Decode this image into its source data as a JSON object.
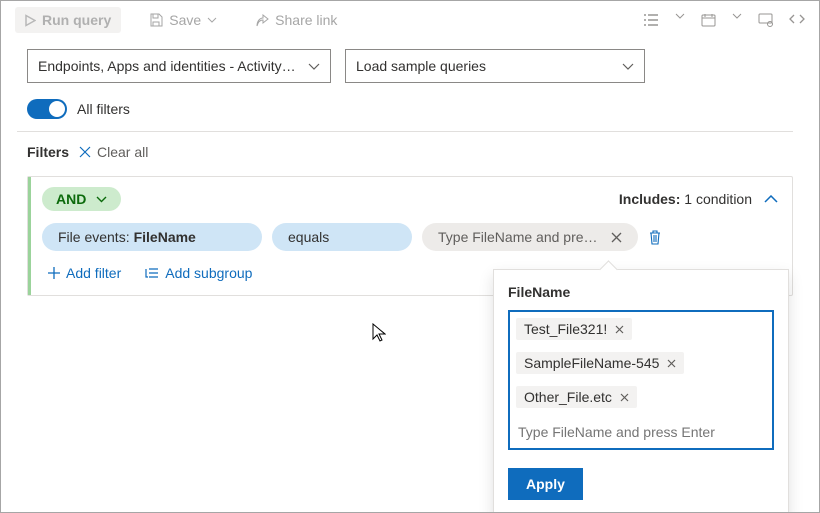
{
  "toolbar": {
    "run_label": "Run query",
    "save_label": "Save",
    "share_label": "Share link"
  },
  "dropdowns": {
    "scope": "Endpoints, Apps and identities - Activity…",
    "samples": "Load sample queries"
  },
  "toggle": {
    "all_filters_label": "All filters"
  },
  "filters_bar": {
    "label": "Filters",
    "clear_label": "Clear all"
  },
  "group": {
    "operator": "AND",
    "includes_prefix": "Includes:",
    "includes_value": "1 condition",
    "field_chip_prefix": "File events: ",
    "field_chip_value": "FileName",
    "op_chip": "equals",
    "value_chip_placeholder": "Type FileName and press …",
    "add_filter_label": "Add filter",
    "add_subgroup_label": "Add subgroup"
  },
  "popover": {
    "title": "FileName",
    "tags": [
      "Test_File321!",
      "SampleFileName-545",
      "Other_File.etc"
    ],
    "input_placeholder": "Type FileName and press Enter",
    "apply_label": "Apply"
  }
}
